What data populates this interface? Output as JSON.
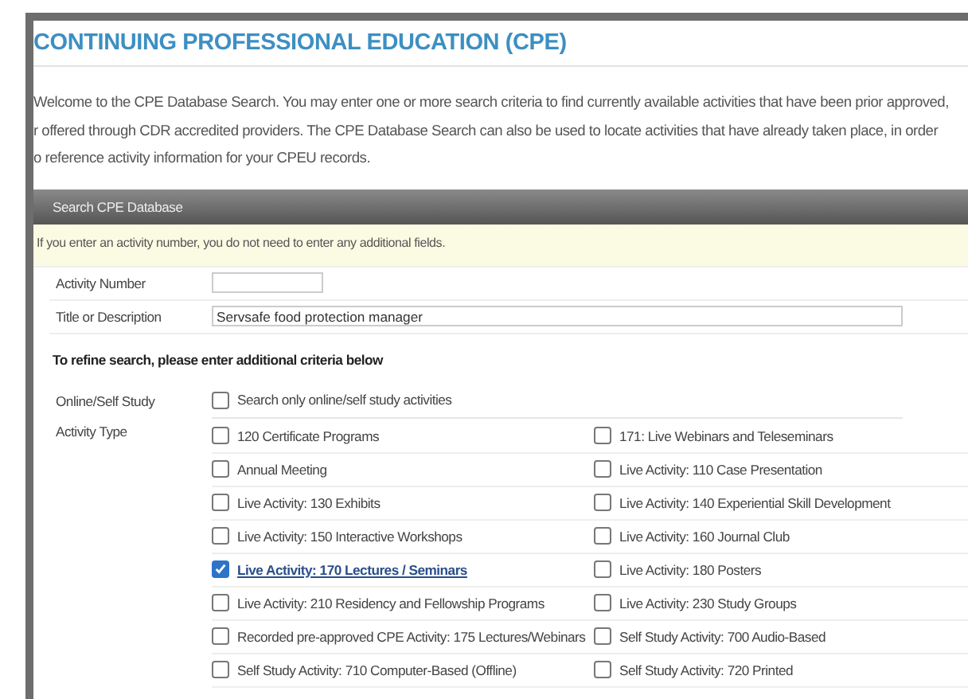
{
  "heading": "CONTINUING PROFESSIONAL EDUCATION (CPE)",
  "intro_lines": [
    "Welcome to the CPE Database Search. You may enter one or more search criteria to find currently available activities that have been prior approved,",
    "r offered through CDR accredited providers. The CPE Database Search can also be used to locate activities that have already taken place, in order",
    "o reference activity information for your CPEU records."
  ],
  "panel": {
    "title": "Search CPE Database",
    "note": "If you enter an activity number, you do not need to enter any additional fields.",
    "fields": [
      {
        "label": "Activity Number"
      },
      {
        "label": "Title or Description",
        "value": "Servsafe food protection manager"
      }
    ],
    "refine_note": "To refine search, please enter additional criteria below",
    "online": {
      "label": "Online/Self Study",
      "option": {
        "label": "Search only online/self study activities",
        "checked": false
      }
    },
    "activity_type": {
      "label": "Activity Type",
      "options": [
        {
          "label": "120 Certificate Programs",
          "checked": false
        },
        {
          "label": "171: Live Webinars and Teleseminars",
          "checked": false
        },
        {
          "label": "Annual Meeting",
          "checked": false
        },
        {
          "label": "Live Activity: 110 Case Presentation",
          "checked": false
        },
        {
          "label": "Live Activity: 130 Exhibits",
          "checked": false
        },
        {
          "label": "Live Activity: 140 Experiential Skill Development",
          "checked": false
        },
        {
          "label": "Live Activity: 150 Interactive Workshops",
          "checked": false
        },
        {
          "label": "Live Activity: 160 Journal Club",
          "checked": false
        },
        {
          "label": "Live Activity: 170 Lectures / Seminars",
          "checked": true
        },
        {
          "label": "Live Activity: 180 Posters",
          "checked": false
        },
        {
          "label": "Live Activity: 210 Residency and Fellowship Programs",
          "checked": false
        },
        {
          "label": "Live Activity: 230 Study Groups",
          "checked": false
        },
        {
          "label": "Recorded pre-approved CPE Activity: 175 Lectures/Webinars",
          "checked": false
        },
        {
          "label": "Self Study Activity: 700 Audio-Based",
          "checked": false
        },
        {
          "label": "Self Study Activity: 710 Computer-Based (Offline)",
          "checked": false
        },
        {
          "label": "Self Study Activity: 720 Printed",
          "checked": false
        }
      ]
    }
  }
}
